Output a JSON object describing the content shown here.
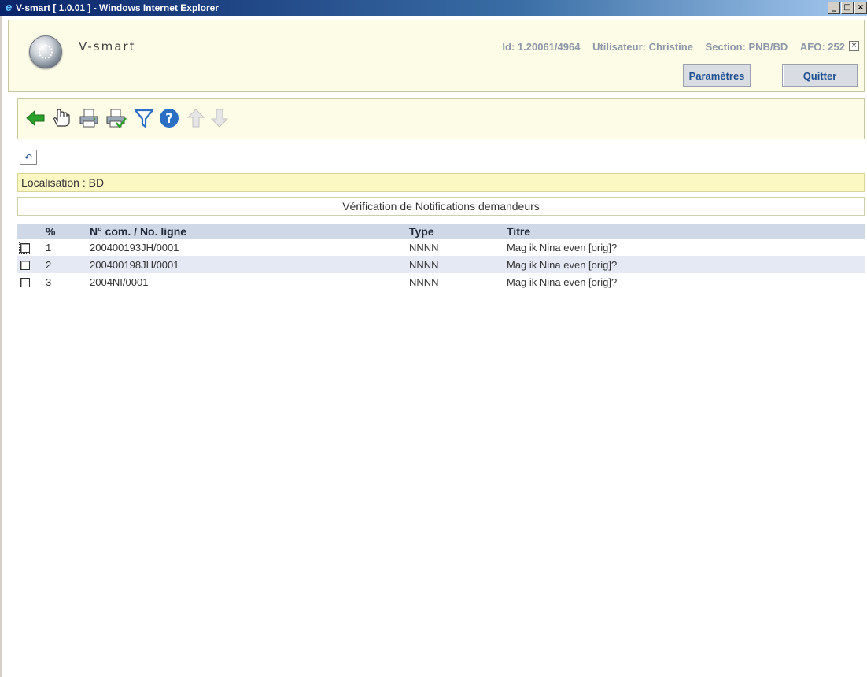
{
  "window": {
    "title": "V-smart [ 1.0.01 ] - Windows Internet Explorer",
    "buttons": {
      "minimize": "_",
      "maximize": "□",
      "close": "×"
    }
  },
  "header": {
    "brand": "V-smart",
    "session": {
      "id": "Id: 1.20061/4964",
      "user": "Utilisateur: Christine",
      "section": "Section: PNB/BD",
      "afo": "AFO: 252"
    },
    "close_glyph": "×",
    "buttons": {
      "parametres": "Paramètres",
      "quitter": "Quitter"
    }
  },
  "toolbar": {
    "icons": [
      "back-arrow-icon",
      "hand-select-icon",
      "print-icon",
      "print-check-icon",
      "filter-funnel-icon",
      "help-icon",
      "arrow-up-icon",
      "arrow-down-icon"
    ],
    "colors": {
      "back": "#2aa12a",
      "filter": "#2b6fc4",
      "help": "#2b6fc4",
      "disabled": "#c8c8c8"
    }
  },
  "undo_glyph": "↶",
  "location": {
    "label": "Localisation : BD"
  },
  "section_title": "Vérification de Notifications demandeurs",
  "table": {
    "columns": {
      "pct": "%",
      "order": "N° com. / No. ligne",
      "type": "Type",
      "title": "Titre"
    },
    "rows": [
      {
        "num": "1",
        "order": "200400193JH/0001",
        "type": "NNNN",
        "title": "Mag ik Nina even [orig]?"
      },
      {
        "num": "2",
        "order": "200400198JH/0001",
        "type": "NNNN",
        "title": "Mag ik Nina even [orig]?"
      },
      {
        "num": "3",
        "order": "2004NI/0001",
        "type": "NNNN",
        "title": "Mag ik Nina even [orig]?"
      }
    ]
  }
}
